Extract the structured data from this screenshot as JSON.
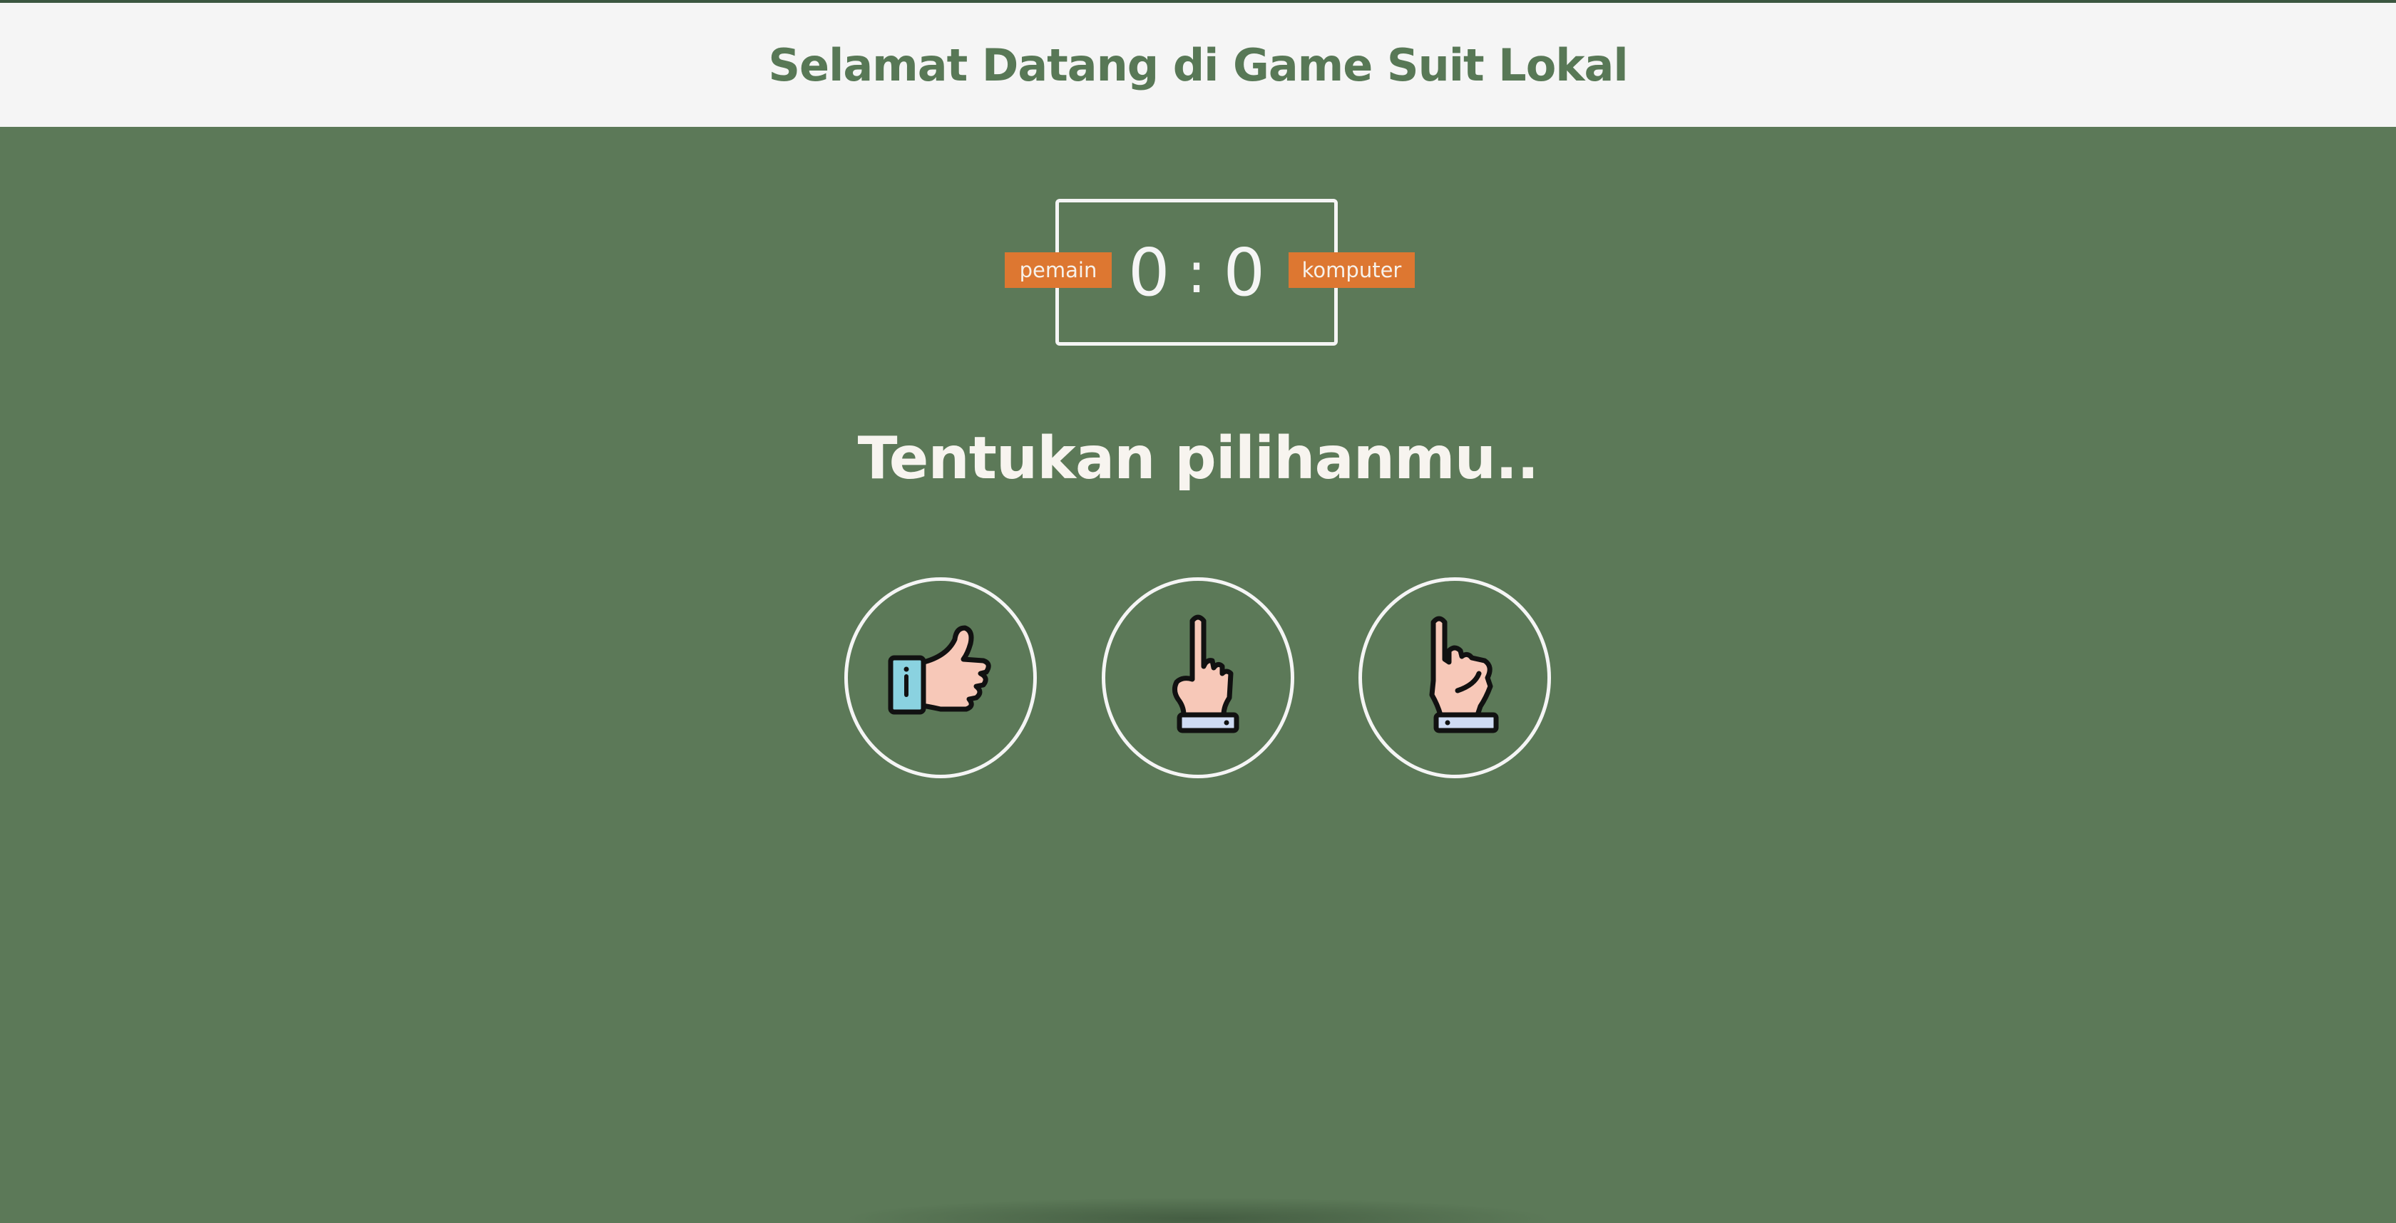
{
  "header": {
    "title": "Selamat Datang di Game Suit Lokal"
  },
  "scoreboard": {
    "player_label": "pemain",
    "player_score": "0",
    "separator": ":",
    "computer_score": "0",
    "computer_label": "komputer"
  },
  "prompt": "Tentukan pilihanmu..",
  "choices": [
    {
      "icon": "thumb-icon"
    },
    {
      "icon": "index-finger-icon"
    },
    {
      "icon": "pinky-finger-icon"
    }
  ],
  "colors": {
    "background": "#5c7958",
    "header_bg": "#f5f5f5",
    "title": "#587856",
    "badge": "#dd7731",
    "skin": "#f7c8b8",
    "cuff": "#cfdbf3",
    "sleeve": "#8ad2e0"
  }
}
